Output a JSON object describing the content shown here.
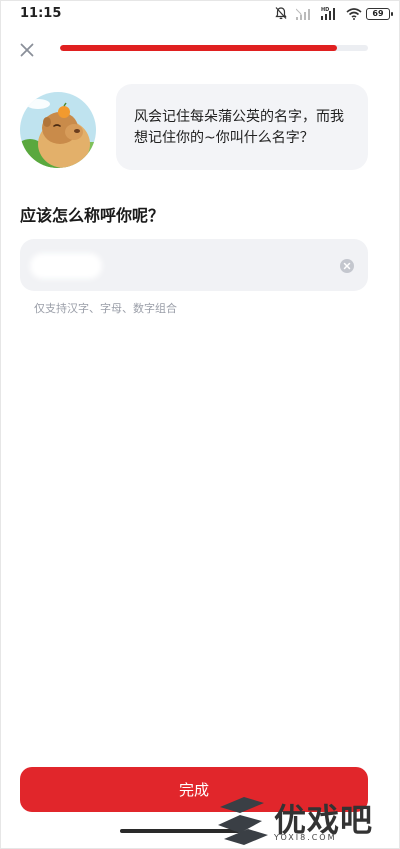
{
  "status_bar": {
    "time": "11:15",
    "battery": "69",
    "icons": [
      "bell-muted-icon",
      "signal-icon",
      "hd-signal-icon",
      "wifi-icon",
      "battery-icon"
    ]
  },
  "header": {
    "close_icon": "close-icon",
    "progress": 0.9
  },
  "bubble": {
    "line1": "风会记住每朵蒲公英的名字，而我",
    "line2": "想记住你的~你叫什么名字？"
  },
  "question": "应该怎么称呼你呢？",
  "input": {
    "value": "",
    "placeholder": "",
    "clear_icon": "clear-circle-icon"
  },
  "hint": "仅支持汉字、字母、数字组合",
  "button": {
    "done_label": "完成"
  },
  "watermark": {
    "text": "优戏吧",
    "url": "YOXI8.COM"
  },
  "colors": {
    "accent": "#e1262b",
    "progress_track": "#eceef2",
    "bubble_bg": "#f3f4f7",
    "input_bg": "#f1f2f5",
    "hint": "#9a9ea8"
  }
}
